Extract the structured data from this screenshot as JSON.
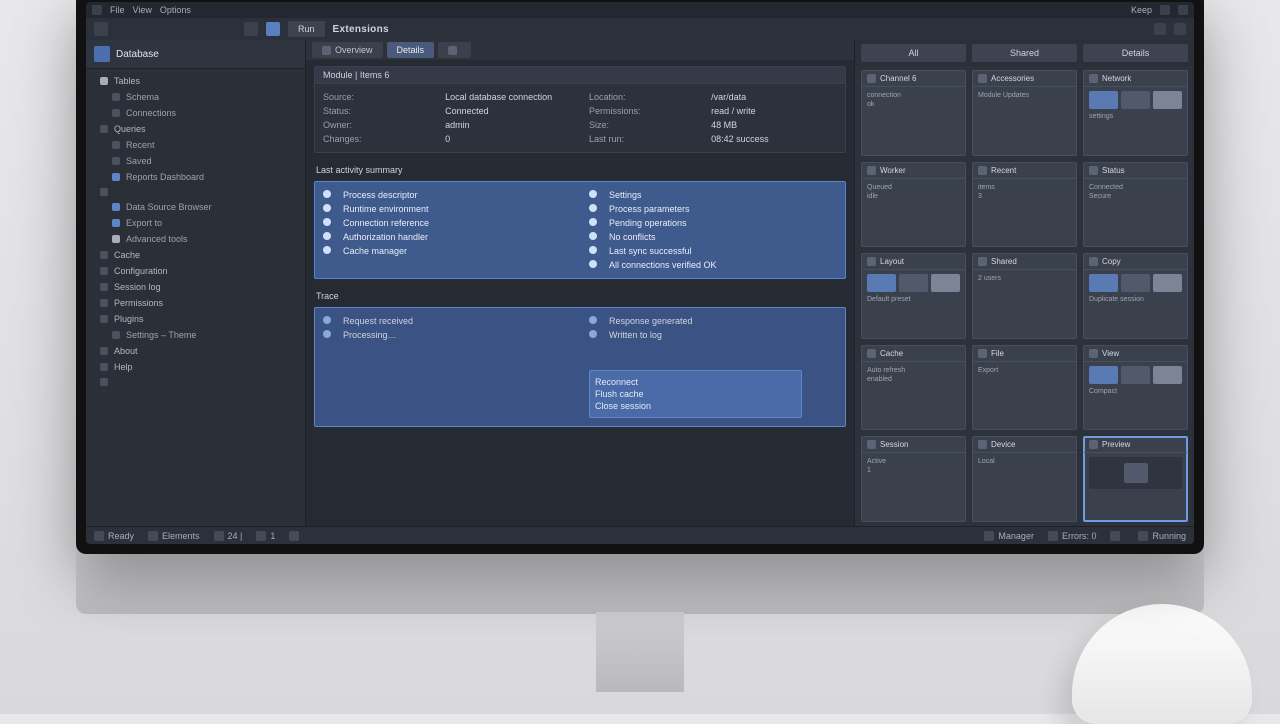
{
  "menu": {
    "items": [
      "File",
      "View",
      "Options"
    ],
    "right": "Keep"
  },
  "toolbar": {
    "title": "Extensions",
    "run_label": "Run"
  },
  "sidebar": {
    "title": "Database",
    "items": [
      {
        "label": "Tables",
        "indent": 0,
        "dot": "light"
      },
      {
        "label": "Schema",
        "indent": 1,
        "dot": ""
      },
      {
        "label": "Connections",
        "indent": 1,
        "dot": ""
      },
      {
        "label": "Queries",
        "indent": 0,
        "dot": ""
      },
      {
        "label": "Recent",
        "indent": 1,
        "dot": ""
      },
      {
        "label": "Saved",
        "indent": 1,
        "dot": ""
      },
      {
        "label": "Reports Dashboard",
        "indent": 1,
        "dot": "blue"
      },
      {
        "label": "",
        "indent": 0,
        "dot": ""
      },
      {
        "label": "Data Source Browser",
        "indent": 1,
        "dot": "blue"
      },
      {
        "label": "Export to",
        "indent": 1,
        "dot": "blue"
      },
      {
        "label": "Advanced tools",
        "indent": 1,
        "dot": "light"
      },
      {
        "label": "Cache",
        "indent": 0,
        "dot": ""
      },
      {
        "label": "Configuration",
        "indent": 0,
        "dot": ""
      },
      {
        "label": "Session log",
        "indent": 0,
        "dot": ""
      },
      {
        "label": "Permissions",
        "indent": 0,
        "dot": ""
      },
      {
        "label": "Plugins",
        "indent": 0,
        "dot": ""
      },
      {
        "label": "Settings – Theme",
        "indent": 1,
        "dot": ""
      },
      {
        "label": "About",
        "indent": 0,
        "dot": ""
      },
      {
        "label": "Help",
        "indent": 0,
        "dot": ""
      },
      {
        "label": "",
        "indent": 0,
        "dot": ""
      }
    ]
  },
  "tabs": [
    {
      "label": "Overview",
      "active": false,
      "icon": true
    },
    {
      "label": "Details",
      "active": true,
      "icon": false
    },
    {
      "label": "",
      "active": false,
      "icon": true
    }
  ],
  "panel1": {
    "header": "Module  |  Items 6",
    "left": [
      {
        "k": "Source:",
        "v": "Local database connection"
      },
      {
        "k": "Status:",
        "v": "Connected"
      },
      {
        "k": "Owner:",
        "v": "admin"
      },
      {
        "k": "Changes:",
        "v": "0"
      }
    ],
    "right": [
      {
        "k": "Location:",
        "v": "/var/data"
      },
      {
        "k": "Permissions:",
        "v": "read / write"
      },
      {
        "k": "Size:",
        "v": "48 MB"
      },
      {
        "k": "Last run:",
        "v": "08:42 success"
      }
    ]
  },
  "detail_title": "Last activity summary",
  "panel2": {
    "left": [
      {
        "k": "",
        "v": "Process descriptor"
      },
      {
        "k": "",
        "v": "Runtime environment"
      },
      {
        "k": "",
        "v": "Connection reference"
      },
      {
        "k": "",
        "v": "Authorization handler"
      },
      {
        "k": "",
        "v": "Cache manager"
      }
    ],
    "right": [
      {
        "k": "",
        "v": "Settings"
      },
      {
        "k": "",
        "v": "Process parameters"
      },
      {
        "k": "",
        "v": "Pending operations"
      },
      {
        "k": "",
        "v": "No conflicts"
      },
      {
        "k": "",
        "v": "Last sync successful"
      },
      {
        "k": "",
        "v": "All connections verified OK"
      }
    ]
  },
  "detail_title2": "Trace",
  "panel3": {
    "left": [
      {
        "k": "",
        "v": "Request received"
      },
      {
        "k": "",
        "v": "Processing…"
      }
    ],
    "right": [
      {
        "k": "",
        "v": "Response generated"
      },
      {
        "k": "",
        "v": "Written to log"
      }
    ],
    "sub": [
      "Reconnect",
      "Flush cache",
      "Close session"
    ]
  },
  "right_tabs": [
    "All",
    "Shared",
    "Details"
  ],
  "cards": [
    {
      "title": "Channel 6",
      "lines": [
        "connection",
        "ok"
      ],
      "thumb": false
    },
    {
      "title": "Accessories",
      "lines": [
        "Module Updates"
      ],
      "thumb": false
    },
    {
      "title": "Network",
      "lines": [
        "settings"
      ],
      "thumb": true,
      "sel": false
    },
    {
      "title": "Worker",
      "lines": [
        "Queued",
        "idle"
      ],
      "thumb": false
    },
    {
      "title": "Recent",
      "lines": [
        "items",
        "3"
      ],
      "thumb": false
    },
    {
      "title": "Status",
      "lines": [
        "Connected",
        "Secure"
      ],
      "thumb": false
    },
    {
      "title": "Layout",
      "lines": [
        "Default preset"
      ],
      "thumb": true
    },
    {
      "title": "Shared",
      "lines": [
        "2 users"
      ],
      "thumb": false
    },
    {
      "title": "Copy",
      "lines": [
        "Duplicate session"
      ],
      "thumb": true
    },
    {
      "title": "Cache",
      "lines": [
        "Auto refresh",
        "enabled"
      ],
      "thumb": false
    },
    {
      "title": "File",
      "lines": [
        "Export"
      ],
      "thumb": false
    },
    {
      "title": "View",
      "lines": [
        "Compact"
      ],
      "thumb": true,
      "sel": false
    },
    {
      "title": "Session",
      "lines": [
        "Active",
        "1"
      ],
      "thumb": false
    },
    {
      "title": "Device",
      "lines": [
        "Local"
      ],
      "thumb": false
    },
    {
      "title": "Preview",
      "lines": [],
      "thumb": false,
      "preview": true,
      "sel": true
    }
  ],
  "status": {
    "items": [
      "Ready",
      "Elements",
      "24 |",
      "1",
      "",
      "Manager",
      "Errors: 0",
      "",
      "Running"
    ]
  }
}
